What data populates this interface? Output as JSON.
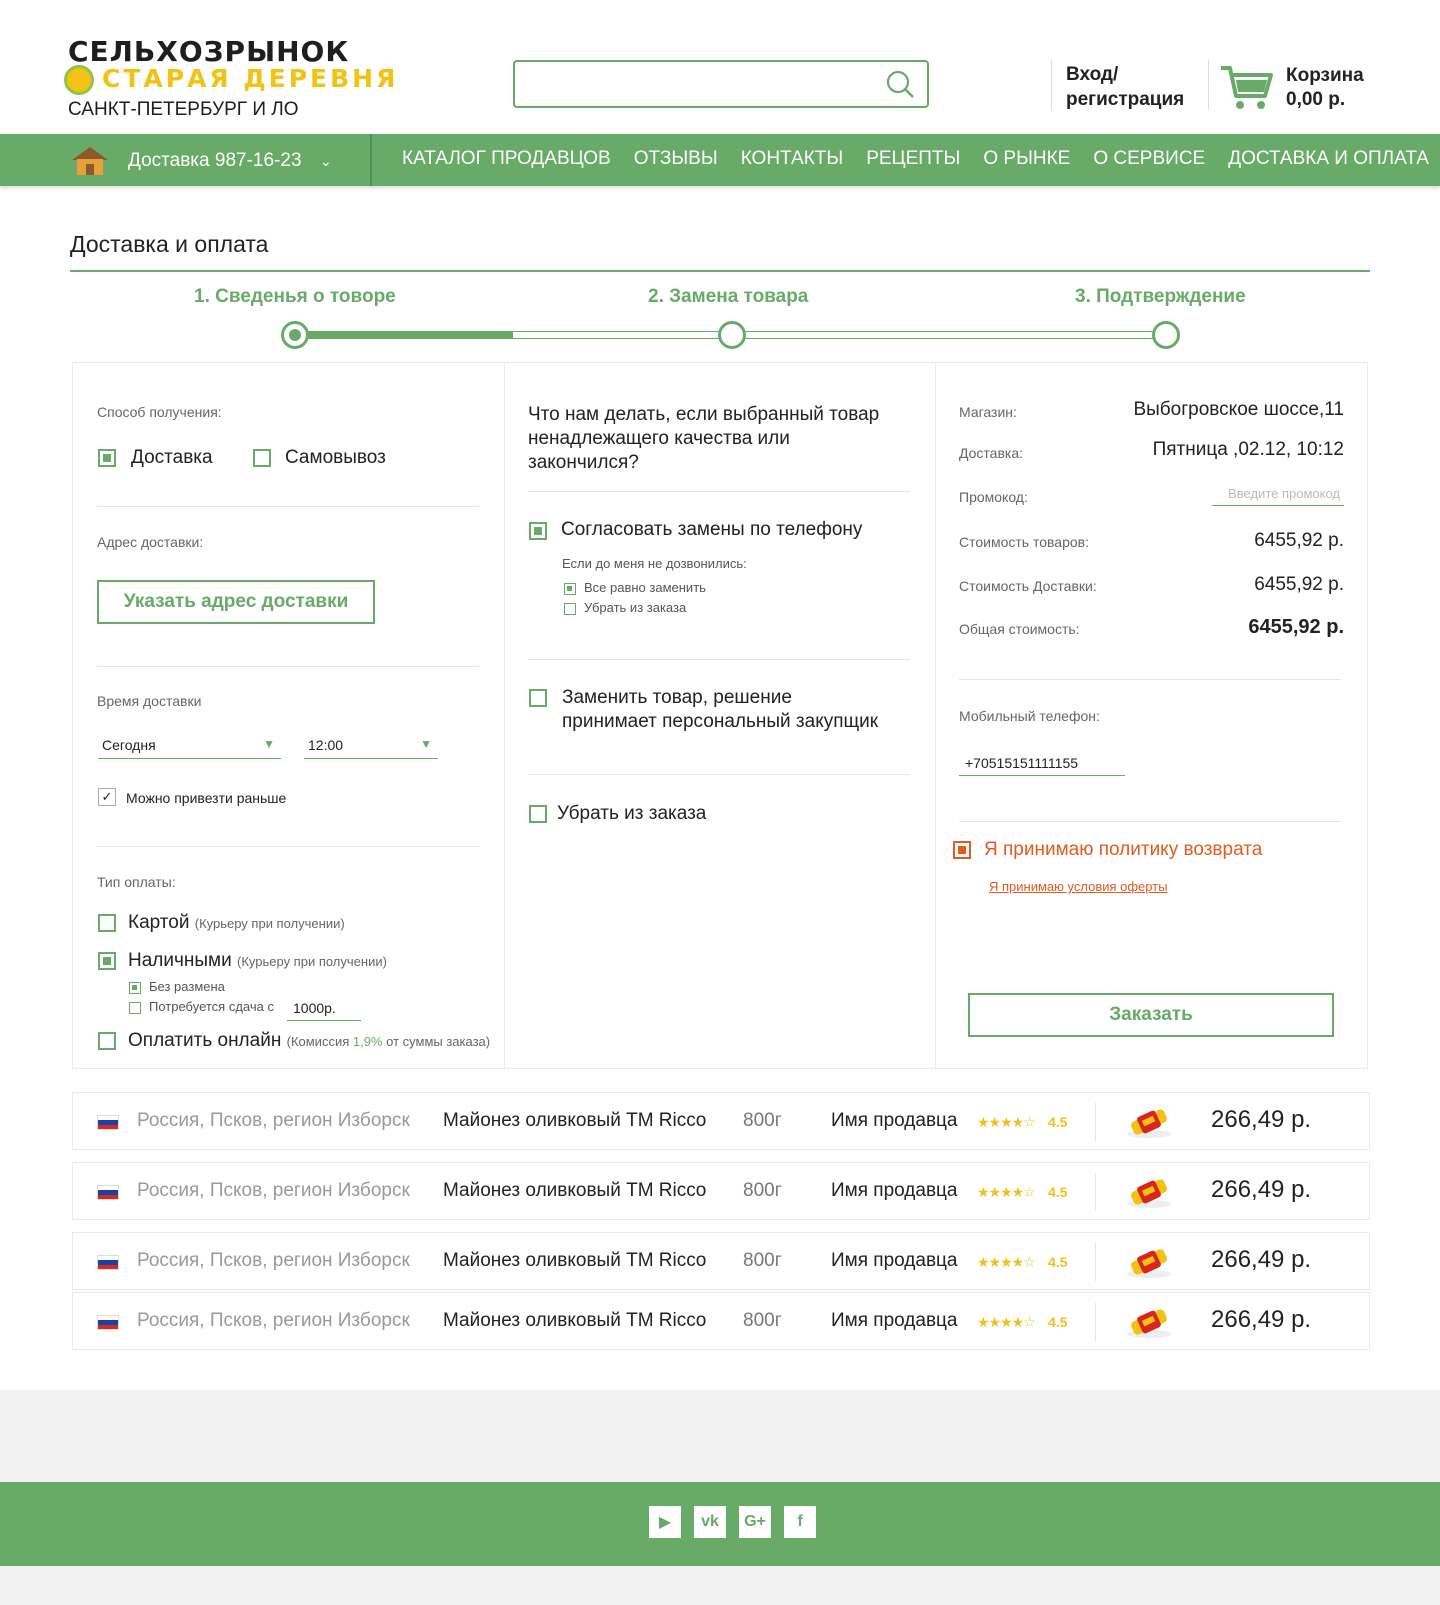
{
  "header": {
    "logo_line1": "СЕЛЬХОЗРЫНОК",
    "logo_line2": "СТАРАЯ ДЕРЕВНЯ",
    "logo_line3": "САНКТ-ПЕТЕРБУРГ И ЛО",
    "search_placeholder": "",
    "login_line1": "Вход/",
    "login_line2": "регистрация",
    "cart_label": "Корзина",
    "cart_amount": "0,00 р."
  },
  "nav": {
    "delivery_label": "Доставка",
    "delivery_phone": "987-16-23",
    "items": [
      "КАТАЛОГ ПРОДАВЦОВ",
      "ОТЗЫВЫ",
      "КОНТАКТЫ",
      "РЕЦЕПТЫ",
      "О РЫНКЕ",
      "О СЕРВИСЕ",
      "ДОСТАВКА И ОПЛАТА"
    ]
  },
  "page": {
    "title": "Доставка и оплата",
    "steps": [
      "1. Сведенья о товоре",
      "2. Замена товара",
      "3. Подтверждение"
    ],
    "active_step": 1,
    "progress_fraction": 0.25
  },
  "col1": {
    "receive_label": "Способ получения:",
    "option_delivery": "Доставка",
    "option_pickup": "Самовывоз",
    "address_label": "Адрес доставки:",
    "address_button": "Указать адрес доставки",
    "time_label": "Время доставки",
    "day_value": "Сегодня",
    "time_value": "12:00",
    "earlier_label": "Можно привезти раньше",
    "payment_label": "Тип оплаты:",
    "pay_card": "Картой",
    "pay_card_hint": "(Курьеру при получении)",
    "pay_cash": "Наличными",
    "pay_cash_hint": "(Курьеру при получении)",
    "no_change": "Без размена",
    "change_from": "Потребуется сдача с",
    "change_value": "1000р.",
    "pay_online": "Оплатить онлайн",
    "online_hint_pre": "(Комиссия",
    "online_hint_pct": "1,9%",
    "online_hint_post": "от суммы заказа)"
  },
  "col2": {
    "question": "Что нам делать, если выбранный товар ненадлежащего качества или закончился?",
    "opt1": "Согласовать замены по телефону",
    "opt1_sub": "Если до меня не дозвонились:",
    "opt1_a": "Все равно заменить",
    "opt1_b": "Убрать из заказа",
    "opt2": "Заменить товар, решение принимает персональный закупщик",
    "opt3": "Убрать из заказа"
  },
  "col3": {
    "store_label": "Магазин:",
    "store_value": "Выбогровское шоссе,11",
    "delivery_label": "Доставка:",
    "delivery_value": "Пятница ,02.12, 10:12",
    "promo_label": "Промокод:",
    "promo_placeholder": "Введите промокод",
    "goods_cost_label": "Стоимость товаров:",
    "goods_cost_value": "6455,92 р.",
    "delivery_cost_label": "Стоимость Доставки:",
    "delivery_cost_value": "6455,92 р.",
    "total_label": "Общая стоимость:",
    "total_value": "6455,92 р.",
    "phone_label": "Мобильный телефон:",
    "phone_value": "+70515151111155",
    "policy_label": "Я принимаю политику возврата",
    "offer_link": "Я принимаю условия оферты",
    "order_button": "Заказать"
  },
  "products": [
    {
      "origin": "Россия, Псков, регион Изборск",
      "name": "Майонез оливковый ТМ Ricco",
      "weight": "800г",
      "seller": "Имя продавца",
      "stars": "★★★★☆",
      "rating": "4.5",
      "price": "266,49 р."
    },
    {
      "origin": "Россия, Псков, регион Изборск",
      "name": "Майонез оливковый ТМ Ricco",
      "weight": "800г",
      "seller": "Имя продавца",
      "stars": "★★★★☆",
      "rating": "4.5",
      "price": "266,49 р."
    },
    {
      "origin": "Россия, Псков, регион Изборск",
      "name": "Майонез оливковый ТМ Ricco",
      "weight": "800г",
      "seller": "Имя продавца",
      "stars": "★★★★☆",
      "rating": "4.5",
      "price": "266,49 р."
    },
    {
      "origin": "Россия, Псков, регион Изборск",
      "name": "Майонез оливковый ТМ Ricco",
      "weight": "800г",
      "seller": "Имя продавца",
      "stars": "★★★★☆",
      "rating": "4.5",
      "price": "266,49 р."
    }
  ],
  "footer": {
    "social_icons": [
      "youtube-icon",
      "vk-icon",
      "google-plus-icon",
      "facebook-icon"
    ],
    "social_glyphs": [
      "▶",
      "vk",
      "G+",
      "f"
    ]
  },
  "colors": {
    "brand_green": "#68ab68",
    "accent_yellow": "#f2c215",
    "warning_orange": "#e45a1f"
  }
}
